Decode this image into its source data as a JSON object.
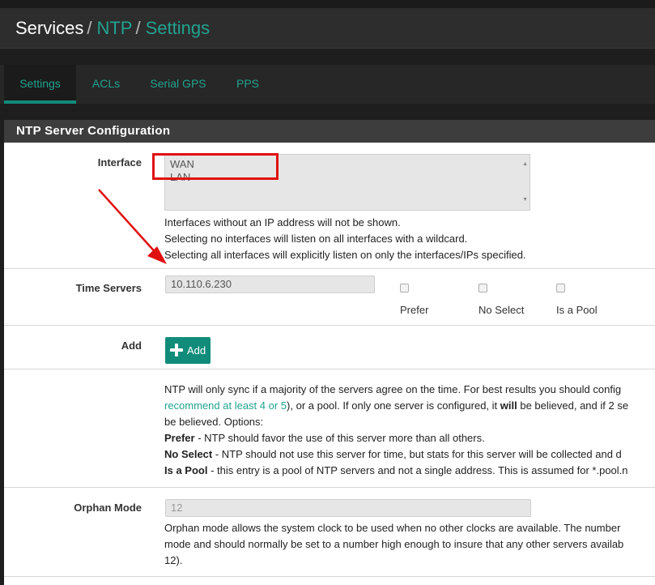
{
  "breadcrumb": {
    "section": "Services",
    "separator": "/",
    "service": "NTP",
    "page": "Settings"
  },
  "tabs": [
    {
      "label": "Settings",
      "active": true
    },
    {
      "label": "ACLs",
      "active": false
    },
    {
      "label": "Serial GPS",
      "active": false
    },
    {
      "label": "PPS",
      "active": false
    }
  ],
  "panel": {
    "title": "NTP Server Configuration"
  },
  "interface": {
    "label": "Interface",
    "options": [
      "WAN",
      "LAN"
    ],
    "help": [
      "Interfaces without an IP address will not be shown.",
      "Selecting no interfaces will listen on all interfaces with a wildcard.",
      "Selecting all interfaces will explicitly listen on only the interfaces/IPs specified."
    ]
  },
  "time_servers": {
    "label": "Time Servers",
    "value": "10.110.6.230",
    "prefer_label": "Prefer",
    "prefer_checked": false,
    "noselect_label": "No Select",
    "noselect_checked": false,
    "pool_label": "Is a Pool",
    "pool_checked": false
  },
  "add": {
    "label": "Add",
    "button_label": "Add"
  },
  "servers_help": {
    "line1": "NTP will only sync if a majority of the servers agree on the time. For best results you should config",
    "line2_link": "recommend at least 4 or 5",
    "line2_a": "), or a pool. If only one server is configured, it ",
    "line2_bold": "will",
    "line2_b": " be believed, and if 2 se",
    "line3": "be believed. Options:",
    "prefer_term": "Prefer",
    "prefer_desc": " - NTP should favor the use of this server more than all others.",
    "noselect_term": "No Select",
    "noselect_desc": " - NTP should not use this server for time, but stats for this server will be collected and d",
    "pool_term": "Is a Pool",
    "pool_desc": " - this entry is a pool of NTP servers and not a single address. This is assumed for *.pool.n"
  },
  "orphan": {
    "label": "Orphan Mode",
    "placeholder": "12",
    "help1": "Orphan mode allows the system clock to be used when no other clocks are available. The number",
    "help2": "mode and should normally be set to a number high enough to insure that any other servers availab",
    "help3": "12)."
  },
  "colors": {
    "accent": "#21a38f",
    "button": "#118c7b",
    "annotation": "#e01010",
    "header_bg": "#2d2d2d",
    "panel_head_bg": "#3d3d3d"
  }
}
